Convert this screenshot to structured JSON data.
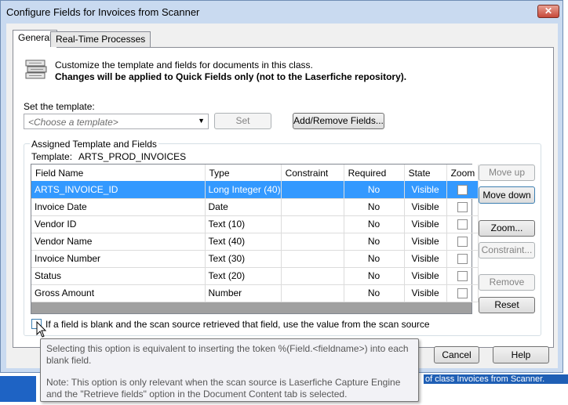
{
  "window": {
    "title": "Configure Fields for Invoices from Scanner",
    "close_label": "✕"
  },
  "tabs": [
    {
      "label": "General",
      "selected": true
    },
    {
      "label": "Real-Time Processes",
      "selected": false
    }
  ],
  "intro": {
    "line1": "Customize the template and fields for documents in this class.",
    "line2": "Changes will be applied to Quick Fields only (not to the Laserfiche repository)."
  },
  "template": {
    "set_label": "Set the template:",
    "placeholder": "<Choose a template>",
    "set_button": "Set",
    "add_remove_button": "Add/Remove Fields..."
  },
  "assigned": {
    "group_title": "Assigned Template and Fields",
    "template_label": "Template:",
    "template_value": "ARTS_PROD_INVOICES"
  },
  "grid": {
    "columns": [
      "Field Name",
      "Type",
      "Constraint",
      "Required",
      "State",
      "Zoom"
    ],
    "rows": [
      {
        "name": "ARTS_INVOICE_ID",
        "type": "Long Integer (40)",
        "constraint": "",
        "required": "No",
        "state": "Visible",
        "zoom": false,
        "selected": true
      },
      {
        "name": "Invoice Date",
        "type": "Date",
        "constraint": "",
        "required": "No",
        "state": "Visible",
        "zoom": false,
        "selected": false
      },
      {
        "name": "Vendor ID",
        "type": "Text (10)",
        "constraint": "",
        "required": "No",
        "state": "Visible",
        "zoom": false,
        "selected": false
      },
      {
        "name": "Vendor Name",
        "type": "Text (40)",
        "constraint": "",
        "required": "No",
        "state": "Visible",
        "zoom": false,
        "selected": false
      },
      {
        "name": "Invoice Number",
        "type": "Text (30)",
        "constraint": "",
        "required": "No",
        "state": "Visible",
        "zoom": false,
        "selected": false
      },
      {
        "name": "Status",
        "type": "Text (20)",
        "constraint": "",
        "required": "No",
        "state": "Visible",
        "zoom": false,
        "selected": false
      },
      {
        "name": "Gross Amount",
        "type": "Number",
        "constraint": "",
        "required": "No",
        "state": "Visible",
        "zoom": false,
        "selected": false
      }
    ]
  },
  "side_buttons": {
    "move_up": "Move up",
    "move_down": "Move down",
    "zoom": "Zoom...",
    "constraint": "Constraint...",
    "remove": "Remove",
    "reset": "Reset"
  },
  "blank_field_option": {
    "label": "If a field is blank and the scan source retrieved that field, use the value from the scan source",
    "checked": false
  },
  "tooltip": {
    "para1": "Selecting this option is equivalent to inserting the token %(Field.<fieldname>) into each blank field.",
    "para2": "Note: This option is only relevant when the scan source is Laserfiche Capture Engine and the \"Retrieve fields\" option in the Document Content tab is selected."
  },
  "footer": {
    "cancel": "Cancel",
    "help": "Help"
  },
  "background": {
    "status_text": "of class Invoices from Scanner."
  },
  "colors": {
    "selection": "#3399ff",
    "window_frame": "#c9daf0"
  }
}
